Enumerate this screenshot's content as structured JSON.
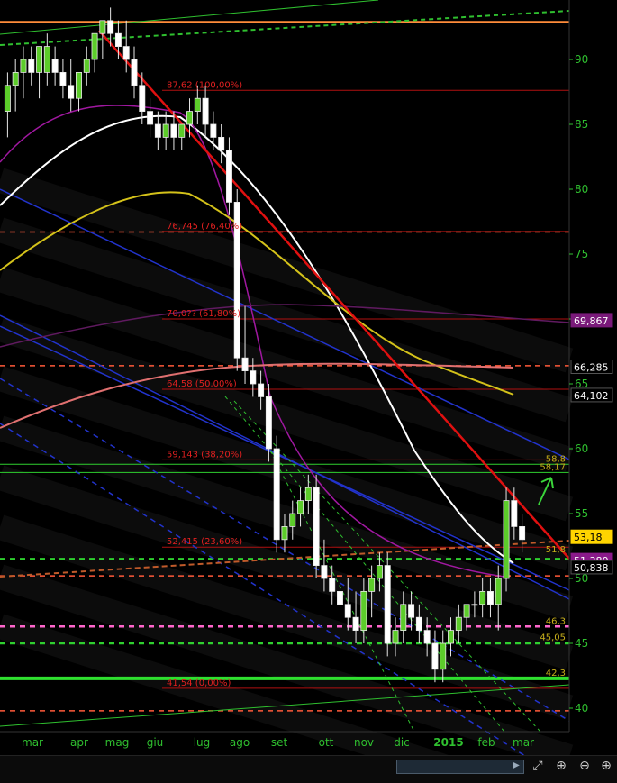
{
  "chart_data": {
    "type": "candlestick",
    "y_ticks": [
      "40",
      "45",
      "50",
      "55",
      "60",
      "65",
      "70",
      "75",
      "80",
      "85",
      "90"
    ],
    "ylim": [
      37.5,
      95
    ],
    "x_labels": [
      "mar",
      "apr",
      "mag",
      "giu",
      "lug",
      "ago",
      "set",
      "ott",
      "nov",
      "dic",
      "2015",
      "feb",
      "mar"
    ],
    "fibonacci_levels": [
      {
        "label": "87,62 (100,00%)",
        "value": 87.62
      },
      {
        "label": "76,745 (76,40%)",
        "value": 76.745
      },
      {
        "label": "70,0?? (61,80%)",
        "value": 70.0
      },
      {
        "label": "64,58 (50,00%)",
        "value": 64.58
      },
      {
        "label": "59,143 (38,20%)",
        "value": 59.143
      },
      {
        "label": "52,415 (23,60%)",
        "value": 52.415
      },
      {
        "label": "41,54 (0,00%)",
        "value": 41.54
      }
    ],
    "price_badges": [
      {
        "label": "69,867",
        "value": 69.867,
        "color": "#7a1a7a"
      },
      {
        "label": "66,285",
        "value": 66.285,
        "color": "#000000"
      },
      {
        "label": "64,102",
        "value": 64.102,
        "color": "#000000"
      },
      {
        "label": "53,18",
        "value": 53.18,
        "color": "#ffd400"
      },
      {
        "label": "51,380",
        "value": 51.38,
        "color": "#8a1a8a"
      },
      {
        "label": "50,838",
        "value": 50.838,
        "color": "#000000"
      }
    ],
    "level_annotations": [
      {
        "label": "58,8",
        "value": 58.8
      },
      {
        "label": "58,17",
        "value": 58.17
      },
      {
        "label": "51,8",
        "value": 51.8
      },
      {
        "label": "46,3",
        "value": 46.3
      },
      {
        "label": "45,05",
        "value": 45.05
      },
      {
        "label": "42,3",
        "value": 42.3
      }
    ],
    "candles": [
      [
        86,
        89,
        84,
        88
      ],
      [
        88,
        90,
        86,
        89
      ],
      [
        89,
        91,
        87,
        90
      ],
      [
        90,
        91,
        88,
        89
      ],
      [
        89,
        91,
        87,
        91
      ],
      [
        89,
        92,
        88,
        91
      ],
      [
        90,
        91,
        88,
        89
      ],
      [
        89,
        90,
        87,
        88
      ],
      [
        88,
        90,
        86,
        87
      ],
      [
        87,
        89,
        86,
        89
      ],
      [
        89,
        91,
        88,
        90
      ],
      [
        90,
        92,
        89,
        92
      ],
      [
        92,
        93,
        90,
        93
      ],
      [
        93,
        94,
        91,
        92
      ],
      [
        92,
        93,
        90,
        91
      ],
      [
        91,
        93,
        89,
        90
      ],
      [
        90,
        91,
        87,
        88
      ],
      [
        88,
        89,
        85,
        86
      ],
      [
        86,
        87,
        84,
        85
      ],
      [
        85,
        86,
        83,
        84
      ],
      [
        84,
        86,
        83,
        85
      ],
      [
        85,
        86,
        83,
        84
      ],
      [
        84,
        85,
        83,
        85
      ],
      [
        85,
        87,
        84,
        86
      ],
      [
        86,
        88,
        85,
        87
      ],
      [
        87,
        88,
        84,
        85
      ],
      [
        85,
        86,
        83,
        84
      ],
      [
        84,
        85,
        82,
        83
      ],
      [
        83,
        84,
        78,
        79
      ],
      [
        79,
        80,
        66,
        67
      ],
      [
        67,
        71,
        65,
        66
      ],
      [
        66,
        67,
        64,
        65
      ],
      [
        65,
        66,
        63,
        64
      ],
      [
        64,
        65,
        59,
        60
      ],
      [
        60,
        61,
        52,
        53
      ],
      [
        53,
        55,
        52,
        54
      ],
      [
        54,
        56,
        53,
        55
      ],
      [
        55,
        57,
        54,
        56
      ],
      [
        56,
        58,
        55,
        57
      ],
      [
        57,
        58,
        50,
        51
      ],
      [
        51,
        53,
        49,
        50
      ],
      [
        50,
        51,
        48,
        49
      ],
      [
        49,
        51,
        47,
        48
      ],
      [
        48,
        50,
        46,
        47
      ],
      [
        47,
        49,
        45,
        46
      ],
      [
        46,
        50,
        45,
        49
      ],
      [
        49,
        51,
        47,
        50
      ],
      [
        50,
        52,
        49,
        51
      ],
      [
        51,
        52,
        44,
        45
      ],
      [
        45,
        47,
        44,
        46
      ],
      [
        46,
        49,
        45,
        48
      ],
      [
        48,
        49,
        46,
        47
      ],
      [
        47,
        48,
        45,
        46
      ],
      [
        46,
        47,
        44,
        45
      ],
      [
        45,
        46,
        42,
        43
      ],
      [
        43,
        46,
        42,
        45
      ],
      [
        45,
        47,
        44,
        46
      ],
      [
        46,
        48,
        45,
        47
      ],
      [
        47,
        48,
        46,
        48
      ],
      [
        48,
        49,
        47,
        48
      ],
      [
        48,
        50,
        47,
        49
      ],
      [
        49,
        50,
        47,
        48
      ],
      [
        48,
        51,
        46,
        50
      ],
      [
        50,
        57,
        49,
        56
      ],
      [
        56,
        57,
        53,
        54
      ],
      [
        54,
        55,
        52,
        53
      ]
    ]
  }
}
